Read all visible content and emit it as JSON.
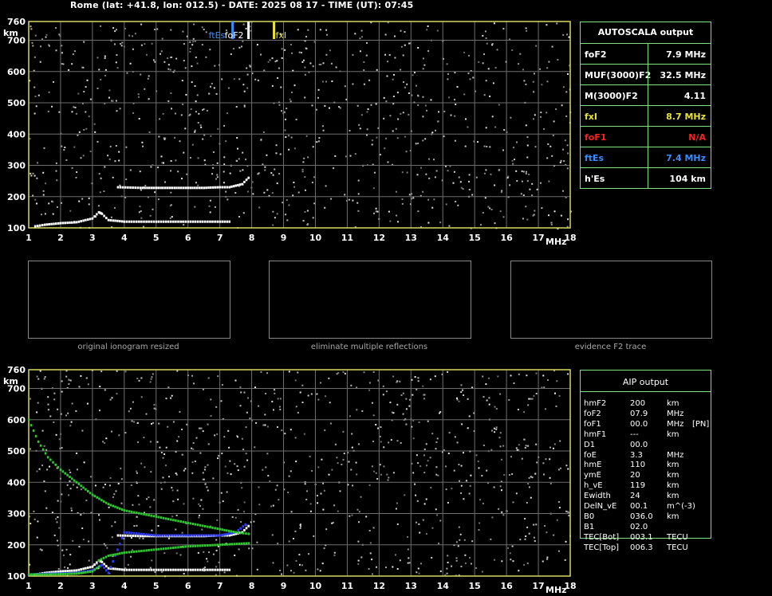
{
  "header": {
    "title": "Rome (lat: +41.8, lon: 012.5) - DATE: 2025 08 17 - TIME (UT): 07:45"
  },
  "top_chart": {
    "y_unit": "km",
    "x_unit": "MHz",
    "marker_labels": {
      "ftEs": "ftEs",
      "foF2": "foF2",
      "fxI": "fxI"
    }
  },
  "bottom_chart": {
    "y_unit": "km",
    "x_unit": "MHz"
  },
  "autoscala": {
    "title": "AUTOSCALA output",
    "rows": [
      {
        "label": "foF2",
        "value": "7.9 MHz",
        "color": "#ffffff"
      },
      {
        "label": "MUF(3000)F2",
        "value": "32.5 MHz",
        "color": "#ffffff"
      },
      {
        "label": "M(3000)F2",
        "value": "4.11",
        "color": "#ffffff"
      },
      {
        "label": "fxI",
        "value": "8.7 MHz",
        "color": "#e8e23a"
      },
      {
        "label": "foF1",
        "value": "N/A",
        "color": "#ff2020"
      },
      {
        "label": "ftEs",
        "value": "7.4 MHz",
        "color": "#3a8cff"
      },
      {
        "label": "h'Es",
        "value": "104    km",
        "color": "#ffffff"
      }
    ]
  },
  "aip": {
    "title": "AIP output",
    "rows": [
      {
        "name": "hmF2",
        "value": "200",
        "unit": "km",
        "flag": ""
      },
      {
        "name": "foF2",
        "value": "07.9",
        "unit": "MHz",
        "flag": ""
      },
      {
        "name": "foF1",
        "value": "00.0",
        "unit": "MHz",
        "flag": "[PN]"
      },
      {
        "name": "hmF1",
        "value": "---",
        "unit": "km",
        "flag": ""
      },
      {
        "name": "D1",
        "value": "00.0",
        "unit": "",
        "flag": ""
      },
      {
        "name": "foE",
        "value": "3.3",
        "unit": "MHz",
        "flag": ""
      },
      {
        "name": "hmE",
        "value": "110",
        "unit": "km",
        "flag": ""
      },
      {
        "name": "ymE",
        "value": "20",
        "unit": "km",
        "flag": ""
      },
      {
        "name": "h_vE",
        "value": "119",
        "unit": "km",
        "flag": ""
      },
      {
        "name": "Ewidth",
        "value": "24",
        "unit": "km",
        "flag": ""
      },
      {
        "name": "DelN_vE",
        "value": "00.1",
        "unit": "m^(-3)",
        "flag": ""
      },
      {
        "name": "B0",
        "value": "036.0",
        "unit": "km",
        "flag": ""
      },
      {
        "name": "B1",
        "value": "02.0",
        "unit": "",
        "flag": ""
      },
      {
        "name": "TEC[Bot]",
        "value": "003.1",
        "unit": "TECU",
        "flag": ""
      },
      {
        "name": "TEC[Top]",
        "value": "006.3",
        "unit": "TECU",
        "flag": ""
      }
    ]
  },
  "thumbnails": {
    "captions": [
      "original ionogram resized",
      "eliminate multiple reflections",
      "evidence F2 trace"
    ]
  },
  "chart_data": [
    {
      "type": "scatter",
      "title": "",
      "xlabel": "MHz",
      "ylabel": "km",
      "xlim": [
        1,
        18
      ],
      "ylim": [
        100,
        760
      ],
      "x_ticks": [
        1,
        2,
        3,
        4,
        5,
        6,
        7,
        8,
        9,
        10,
        11,
        12,
        13,
        14,
        15,
        16,
        17,
        18
      ],
      "y_ticks": [
        100,
        200,
        300,
        400,
        500,
        600,
        700,
        760
      ],
      "grid": true,
      "markers": [
        {
          "name": "ftEs",
          "x": 7.4,
          "color": "#3a8cff"
        },
        {
          "name": "foF2",
          "x": 7.9,
          "color": "#ffffff"
        },
        {
          "name": "fxI",
          "x": 8.7,
          "color": "#e8e23a"
        }
      ],
      "series": [
        {
          "color": "#ffffff",
          "x": [
            1.2,
            1.5,
            2.0,
            2.5,
            3.0,
            3.2,
            3.3,
            3.5,
            4.0,
            5.0,
            6.0,
            7.0,
            7.3
          ],
          "y": [
            105,
            110,
            115,
            118,
            130,
            150,
            145,
            125,
            120,
            120,
            120,
            120,
            120
          ]
        },
        {
          "color": "#ffffff",
          "x": [
            3.8,
            4.5,
            5.0,
            5.5,
            6.0,
            6.5,
            7.0,
            7.3,
            7.5,
            7.7,
            7.9
          ],
          "y": [
            230,
            228,
            228,
            228,
            228,
            228,
            230,
            230,
            235,
            240,
            260
          ]
        }
      ]
    },
    {
      "type": "scatter",
      "title": "",
      "xlabel": "MHz",
      "ylabel": "km",
      "xlim": [
        1,
        18
      ],
      "ylim": [
        100,
        760
      ],
      "x_ticks": [
        1,
        2,
        3,
        4,
        5,
        6,
        7,
        8,
        9,
        10,
        11,
        12,
        13,
        14,
        15,
        16,
        17,
        18
      ],
      "y_ticks": [
        100,
        200,
        300,
        400,
        500,
        600,
        700,
        760
      ],
      "grid": true,
      "series": [
        {
          "color": "#ffffff",
          "x": [
            1.2,
            1.5,
            2.0,
            2.5,
            3.0,
            3.2,
            3.3,
            3.5,
            4.0,
            5.0,
            6.0,
            7.0,
            7.3
          ],
          "y": [
            105,
            110,
            115,
            118,
            130,
            150,
            145,
            125,
            120,
            120,
            120,
            120,
            120
          ]
        },
        {
          "color": "#ffffff",
          "x": [
            3.8,
            4.5,
            5.0,
            5.5,
            6.0,
            6.5,
            7.0,
            7.3,
            7.5,
            7.7,
            7.9
          ],
          "y": [
            230,
            228,
            228,
            228,
            228,
            228,
            230,
            230,
            235,
            240,
            260
          ]
        },
        {
          "color": "#2e3cff",
          "x": [
            1.0,
            1.5,
            2.0,
            2.5,
            3.0,
            3.2,
            3.3,
            3.5,
            4.0,
            5.0,
            6.0,
            7.0,
            7.5,
            7.8
          ],
          "y": [
            105,
            107,
            108,
            110,
            118,
            130,
            135,
            110,
            240,
            230,
            230,
            230,
            240,
            265
          ]
        },
        {
          "color": "#2ec82e",
          "x": [
            1.0,
            1.3,
            1.6,
            2.0,
            2.5,
            3.0,
            3.5,
            4.0,
            5.0,
            6.0,
            7.0,
            7.5,
            7.9
          ],
          "y": [
            600,
            530,
            480,
            440,
            400,
            360,
            330,
            310,
            290,
            270,
            250,
            240,
            235
          ]
        },
        {
          "color": "#2ec82e",
          "x": [
            3.2,
            3.5,
            4.0,
            5.0,
            6.0,
            7.0,
            7.9
          ],
          "y": [
            150,
            165,
            175,
            185,
            195,
            200,
            205
          ]
        },
        {
          "color": "#2ec82e",
          "x": [
            1.0,
            1.5,
            2.0,
            2.5,
            3.0,
            3.2
          ],
          "y": [
            105,
            105,
            106,
            108,
            115,
            130
          ]
        }
      ]
    }
  ]
}
